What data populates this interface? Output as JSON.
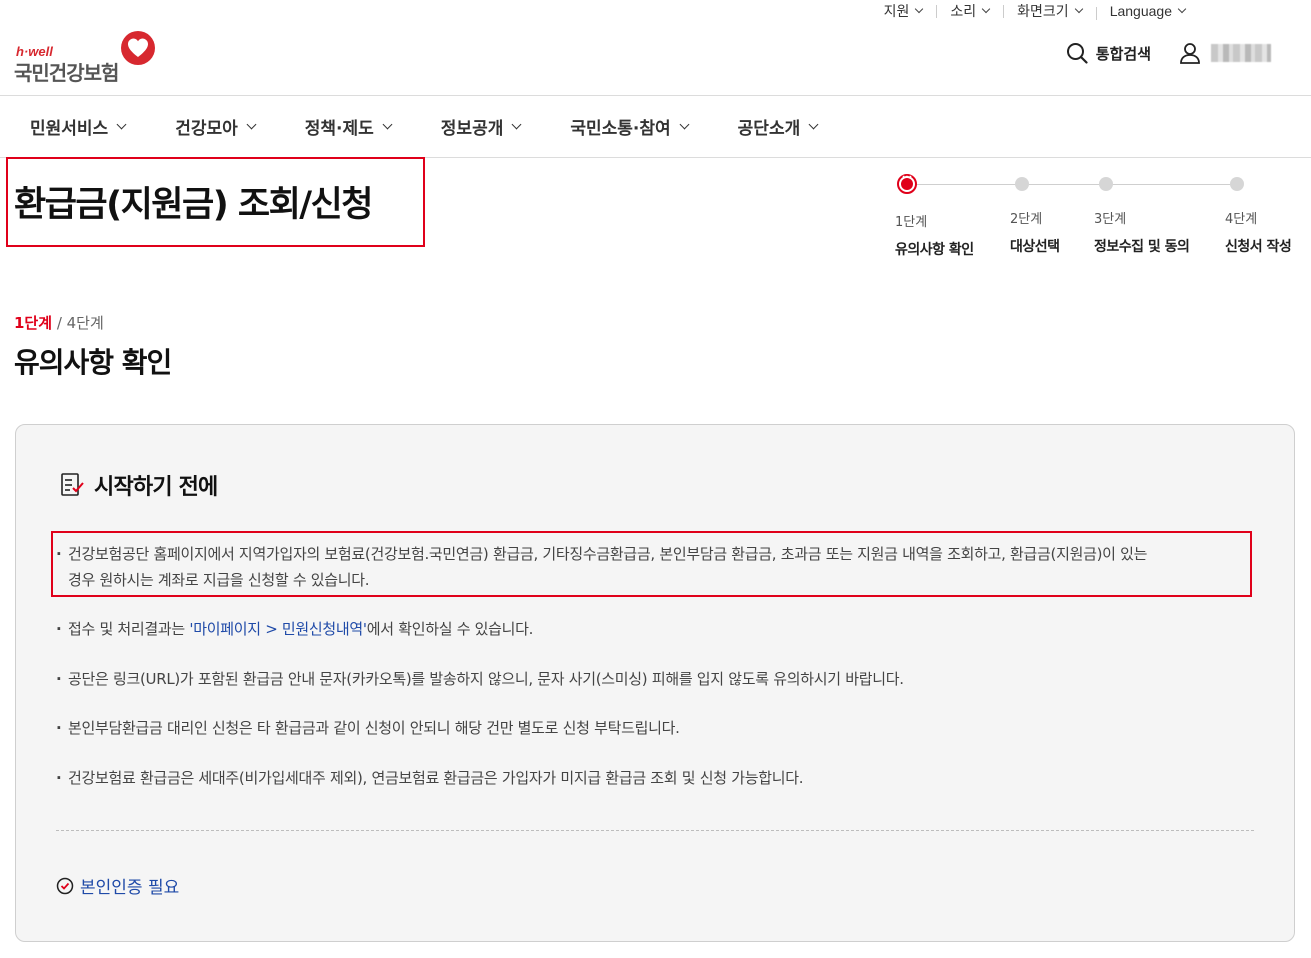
{
  "util": {
    "support": "지원",
    "sound": "소리",
    "screen_size": "화면크기",
    "language": "Language"
  },
  "logo": {
    "brand": "h·well",
    "name": "국민건강보험"
  },
  "header": {
    "search_label": "통합검색"
  },
  "gnb": [
    {
      "label": "민원서비스"
    },
    {
      "label": "건강모아"
    },
    {
      "label": "정책·제도"
    },
    {
      "label": "정보공개"
    },
    {
      "label": "국민소통·참여"
    },
    {
      "label": "공단소개"
    }
  ],
  "page_title": "환급금(지원금) 조회/신청",
  "stepper": [
    {
      "num": "1단계",
      "label": "유의사항 확인",
      "active": true
    },
    {
      "num": "2단계",
      "label": "대상선택",
      "active": false
    },
    {
      "num": "3단계",
      "label": "정보수집 및 동의",
      "active": false
    },
    {
      "num": "4단계",
      "label": "신청서 작성",
      "active": false
    }
  ],
  "step_indicator": {
    "current": "1단계",
    "separator": " / ",
    "total": "4단계"
  },
  "subtitle": "유의사항 확인",
  "notice": {
    "title": "시작하기 전에",
    "items": {
      "i0_line1": "건강보험공단 홈페이지에서 지역가입자의 보험료(건강보험.국민연금) 환급금, 기타징수금환급금, 본인부담금 환급금, 초과금 또는 지원금 내역을 조회하고, 환급금(지원금)이 있는",
      "i0_line2": "경우 원하시는 계좌로 지급을 신청할 수 있습니다.",
      "i1_pre": "접수 및 처리결과는 ",
      "i1_link": "'마이페이지 > 민원신청내역'",
      "i1_post": "에서 확인하실 수 있습니다.",
      "i2": "공단은 링크(URL)가 포함된 환급금 안내 문자(카카오톡)를 발송하지 않으니, 문자 사기(스미싱) 피해를 입지 않도록 유의하시기 바랍니다.",
      "i3": "본인부담환급금 대리인 신청은 타 환급금과 같이 신청이 안되니 해당 건만 별도로 신청 부탁드립니다.",
      "i4": "건강보험료 환급금은 세대주(비가입세대주 제외), 연금보험료 환급금은 가입자가 미지급 환급금 조회 및 신청 가능합니다."
    },
    "auth_label": "본인인증 필요"
  },
  "colors": {
    "accent_red": "#e0001a",
    "link_blue": "#1f4aa8"
  }
}
